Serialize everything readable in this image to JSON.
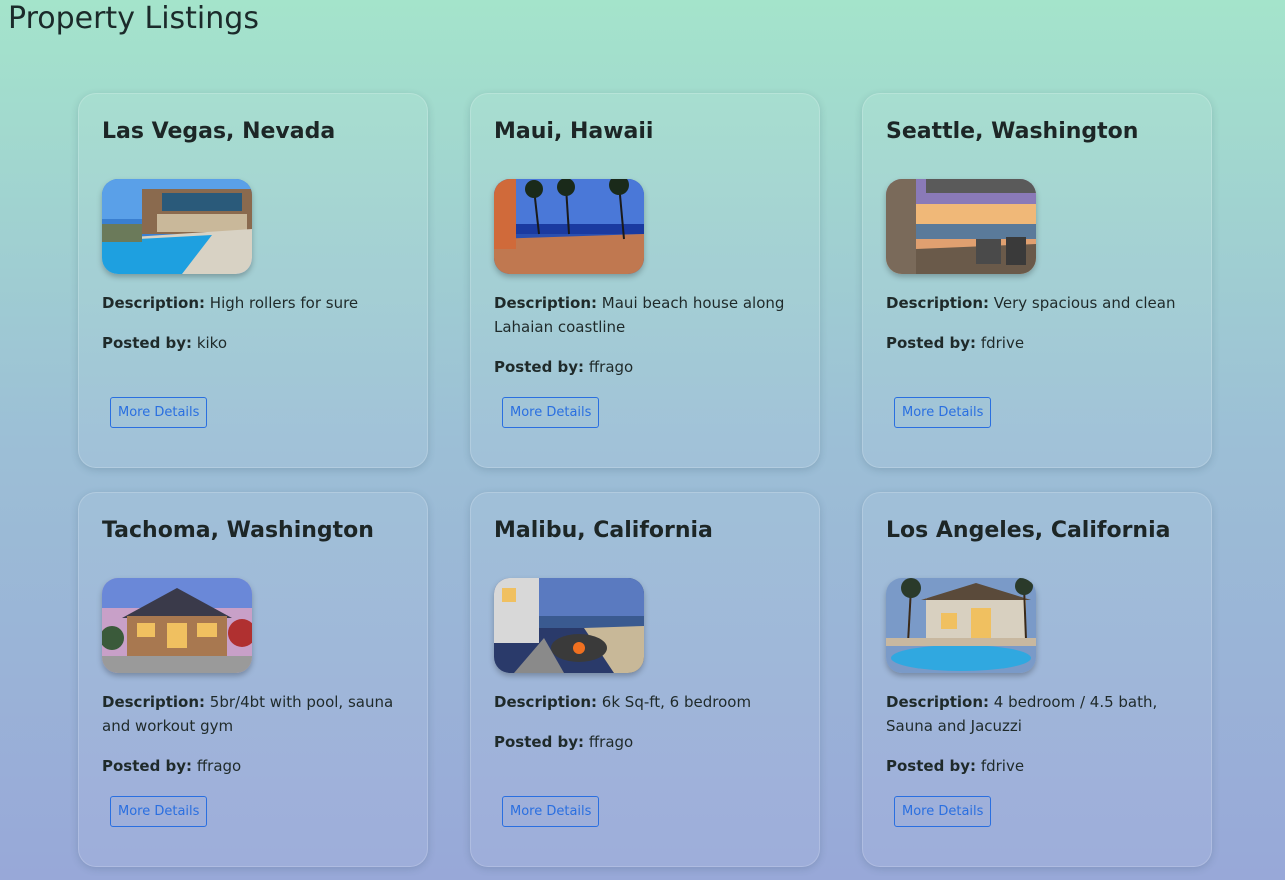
{
  "page": {
    "title": "Property Listings"
  },
  "labels": {
    "description": "Description:",
    "posted_by": "Posted by:",
    "button": "More Details"
  },
  "listings": [
    {
      "location": "Las Vegas, Nevada",
      "description": "High rollers for sure",
      "posted_by": "kiko",
      "image": "pool-villa-photo"
    },
    {
      "location": "Maui, Hawaii",
      "description": "Maui beach house along Lahaian coastline",
      "posted_by": "ffrago",
      "image": "beach-terrace-photo"
    },
    {
      "location": "Seattle, Washington",
      "description": "Very spacious and clean",
      "posted_by": "fdrive",
      "image": "balcony-view-photo"
    },
    {
      "location": "Tachoma, Washington",
      "description": "5br/4bt with pool, sauna and workout gym",
      "posted_by": "ffrago",
      "image": "house-dusk-photo"
    },
    {
      "location": "Malibu, California",
      "description": "6k Sq-ft, 6 bedroom",
      "posted_by": "ffrago",
      "image": "beachfront-firepit-photo"
    },
    {
      "location": "Los Angeles, California",
      "description": "4 bedroom / 4.5 bath, Sauna and Jacuzzi",
      "posted_by": "fdrive",
      "image": "palm-pool-mansion-photo"
    }
  ]
}
